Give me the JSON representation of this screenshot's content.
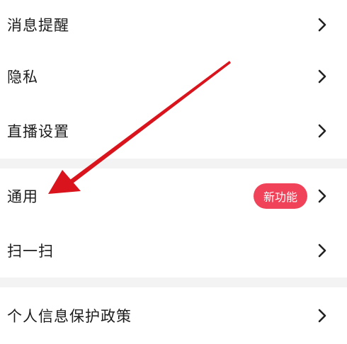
{
  "settings": {
    "items": [
      {
        "label": "消息提醒"
      },
      {
        "label": "隐私"
      },
      {
        "label": "直播设置"
      },
      {
        "label": "通用",
        "badge": "新功能"
      },
      {
        "label": "扫一扫"
      },
      {
        "label": "个人信息保护政策"
      }
    ]
  },
  "colors": {
    "badge_bg": "#f0435a",
    "annotation_arrow": "#d9141c",
    "separator": "#f3f3f3"
  },
  "icons": {
    "row_chevron": "chevron-right-icon"
  }
}
